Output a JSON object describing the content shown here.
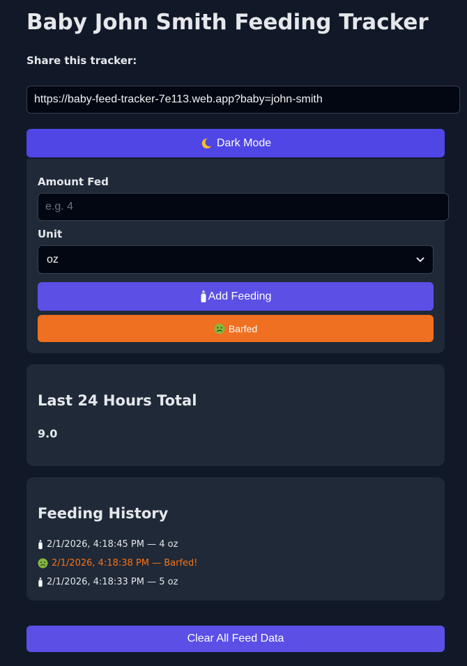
{
  "header": {
    "title": "Baby John Smith Feeding Tracker",
    "share_label": "Share this tracker:",
    "share_url": "https://baby-feed-tracker-7e113.web.app?baby=john-smith"
  },
  "theme_toggle": {
    "label": "Dark Mode",
    "icon": "moon-icon"
  },
  "form": {
    "amount_label": "Amount Fed",
    "amount_placeholder": "e.g. 4",
    "amount_value": "",
    "unit_label": "Unit",
    "unit_selected": "oz",
    "add_label": "Add Feeding",
    "add_icon": "baby-bottle-icon",
    "barf_label": "Barfed",
    "barf_icon": "nauseated-face-icon"
  },
  "total": {
    "title": "Last 24 Hours Total",
    "value": "9.0"
  },
  "history": {
    "title": "Feeding History",
    "items": [
      {
        "type": "feed",
        "icon": "baby-bottle-icon",
        "text": "2/1/2026, 4:18:45 PM — 4 oz"
      },
      {
        "type": "barf",
        "icon": "nauseated-face-icon",
        "text": "2/1/2026, 4:18:38 PM — Barfed!"
      },
      {
        "type": "feed",
        "icon": "baby-bottle-icon",
        "text": "2/1/2026, 4:18:33 PM — 5 oz"
      }
    ]
  },
  "clear_label": "Clear All Feed Data",
  "colors": {
    "background": "#111827",
    "card": "#1f2937",
    "primary": "#5b4fe6",
    "barf": "#ef7020",
    "barf_text": "#f97316"
  }
}
